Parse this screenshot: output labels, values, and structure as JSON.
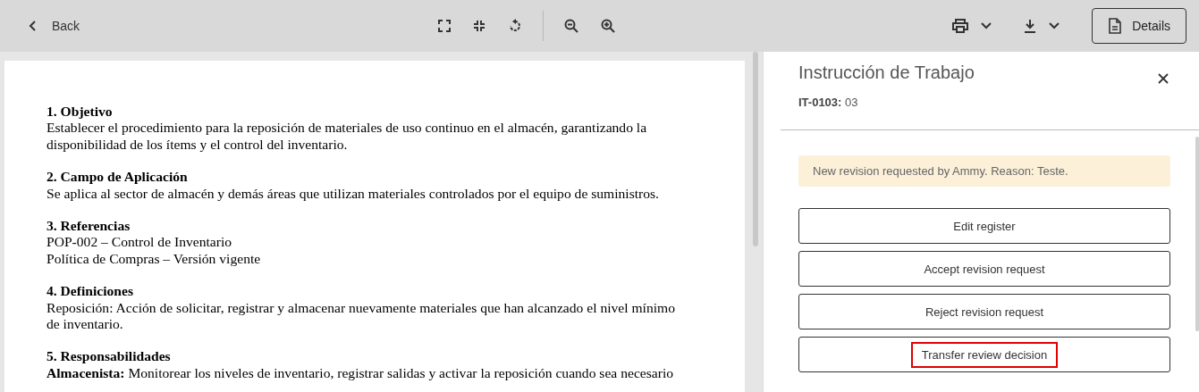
{
  "toolbar": {
    "back": {
      "label": "Back"
    },
    "details": {
      "label": "Details"
    }
  },
  "document": {
    "sections": [
      {
        "heading": "1. Objetivo",
        "lines": [
          "Establecer el procedimiento para la reposición de materiales de uso continuo en el almacén, garantizando la disponibilidad de los ítems y el control del inventario."
        ]
      },
      {
        "heading": "2. Campo de Aplicación",
        "lines": [
          "Se aplica al sector de almacén y demás áreas que utilizan materiales controlados por el equipo de suministros."
        ]
      },
      {
        "heading": "3. Referencias",
        "lines": [
          "POP-002 – Control de Inventario",
          "Política de Compras – Versión vigente"
        ]
      },
      {
        "heading": "4. Definiciones",
        "lines": [
          "Reposición: Acción de solicitar, registrar y almacenar nuevamente materiales que han alcanzado el nivel mínimo de inventario."
        ]
      },
      {
        "heading": "5. Responsabilidades",
        "lines": [
          "**Almacenista:** Monitorear los niveles de inventario, registrar salidas y activar la reposición cuando sea necesario"
        ]
      }
    ]
  },
  "panel": {
    "title": "Instrucción de Trabajo",
    "code": "IT-0103:",
    "version": "03",
    "notice": "New revision requested by Ammy. Reason: Teste.",
    "actions": [
      {
        "label": "Edit register",
        "highlighted": false
      },
      {
        "label": "Accept revision request",
        "highlighted": false
      },
      {
        "label": "Reject revision request",
        "highlighted": false
      },
      {
        "label": "Transfer review decision",
        "highlighted": true
      }
    ]
  }
}
